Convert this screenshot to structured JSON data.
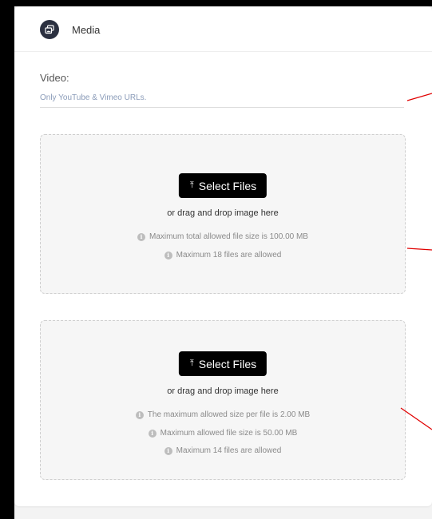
{
  "header": {
    "title": "Media",
    "icon": "gallery-icon"
  },
  "video": {
    "label": "Video:",
    "placeholder": "Only YouTube & Vimeo URLs.",
    "value": ""
  },
  "dropzones": [
    {
      "button_label": "Select Files",
      "drop_text": "or drag and drop image here",
      "info": [
        "Maximum total allowed file size is 100.00 MB",
        "Maximum 18 files are allowed"
      ]
    },
    {
      "button_label": "Select Files",
      "drop_text": "or drag and drop image here",
      "info": [
        "The maximum allowed size per file is 2.00 MB",
        "Maximum allowed file size is 50.00 MB",
        "Maximum 14 files are allowed"
      ]
    }
  ],
  "colors": {
    "annotation_line": "#e00000",
    "button_bg": "#000000",
    "header_icon_bg": "#2b3040",
    "placeholder": "#8a9bb8"
  }
}
